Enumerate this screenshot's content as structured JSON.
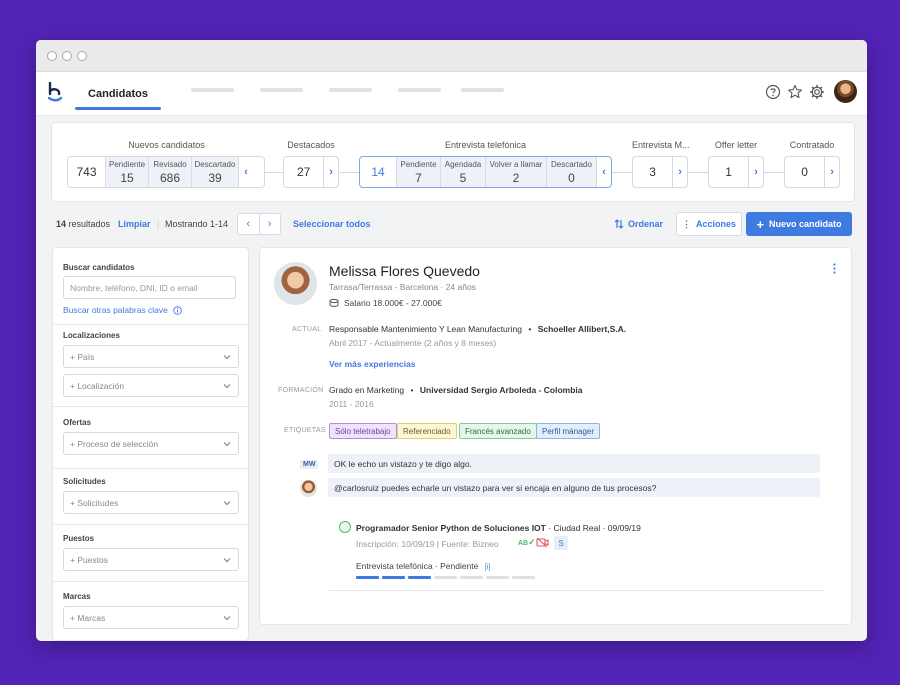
{
  "app": {
    "active_tab": "Candidatos",
    "nav_placeholders": 5,
    "top_icons": [
      "help-icon",
      "star-icon",
      "gear-icon"
    ]
  },
  "pipeline": {
    "nuevos": {
      "title": "Nuevos candidatos",
      "total": "743",
      "sub": [
        {
          "label": "Pendiente",
          "value": "15"
        },
        {
          "label": "Revisado",
          "value": "686"
        },
        {
          "label": "Descartado",
          "value": "39"
        }
      ]
    },
    "destacados": {
      "title": "Destacados",
      "total": "27"
    },
    "entrevista_tel": {
      "title": "Entrevista telefónica",
      "total": "14",
      "sub": [
        {
          "label": "Pendiente",
          "value": "7"
        },
        {
          "label": "Agendada",
          "value": "5"
        },
        {
          "label": "Volver a llamar",
          "value": "2"
        },
        {
          "label": "Descartado",
          "value": "0"
        }
      ]
    },
    "entrevista_m": {
      "title": "Entrevista M...",
      "total": "3"
    },
    "offer": {
      "title": "Offer letter",
      "total": "1"
    },
    "contratado": {
      "title": "Contratado",
      "total": "0"
    }
  },
  "results": {
    "count_num": "14",
    "count_suffix": "resultados",
    "clear": "Limpiar",
    "showing": "Mostrando 1-14",
    "select_all": "Seleccionar todos",
    "sort": "Ordenar",
    "actions": "Acciones",
    "new_candidate": "Nuevo candidato"
  },
  "filters": {
    "search_title": "Buscar candidatos",
    "search_placeholder": "Nombre, teléfono, DNI, ID o email",
    "keywords_link": "Buscar otras palabras clave",
    "loc_title": "Localizaciones",
    "pais": "+ País",
    "localizacion": "+ Localización",
    "ofertas_title": "Ofertas",
    "proceso": "+ Proceso de selección",
    "solicitudes_title": "Solicitudes",
    "solicitudes": "+ Solicitudes",
    "puestos_title": "Puestos",
    "puestos": "+ Puestos",
    "marcas_title": "Marcas",
    "marcas": "+ Marcas"
  },
  "candidate": {
    "name": "Melissa Flores Quevedo",
    "location": "Tarrasa/Terrassa - Barcelona · 24 años",
    "salary": "Salario 18.000€ - 27.000€",
    "actual_label": "ACTUAL",
    "job": "Responsable Mantenimiento Y Lean Manufacturing",
    "company": "Schoeller Allibert,S.A.",
    "job_dates": "Abril 2017 - Actualmente (2 años y 8 meses)",
    "more_exp": "Ver más experiencias",
    "edu_label": "FORMACIÓN",
    "degree": "Grado en Marketing",
    "university": "Universidad Sergio Arboleda - Colombia",
    "edu_dates": "2011 - 2016",
    "tags_label": "ETIQUETAS",
    "tags": [
      {
        "label": "Sólo teletrabajo",
        "bg": "#efe3fa",
        "border": "#b68be0",
        "color": "#6b3fa0"
      },
      {
        "label": "Referenciado",
        "bg": "#fdf6d8",
        "border": "#e4cf6a",
        "color": "#6d5e1a"
      },
      {
        "label": "Francés avanzado",
        "bg": "#e5f6ea",
        "border": "#7fcc96",
        "color": "#2f6e43"
      },
      {
        "label": "Perfil mánager",
        "bg": "#e4eefb",
        "border": "#8db3e8",
        "color": "#2f5a99"
      }
    ],
    "comments": [
      {
        "author": "MW",
        "text": "OK le echo un vistazo y te digo algo."
      },
      {
        "author": "",
        "text": "@carlosruiz puedes echarle un vistazo para ver si encaja en alguno de tus procesos?"
      }
    ],
    "application": {
      "title": "Programador Senior Python de Soluciones IOT",
      "place_date": "· Ciudad Real · 09/09/19",
      "meta": "Inscripción: 10/09/19 | Fuente: Bizneo",
      "badge_ab": "AB",
      "badge_s": "S",
      "status": "Entrevista telefónica · Pendiente",
      "status_marker": "[i]",
      "steps_done": 3,
      "steps_total": 7
    }
  },
  "colors": {
    "accent": "#3f7ae0",
    "background": "#5423b8"
  }
}
